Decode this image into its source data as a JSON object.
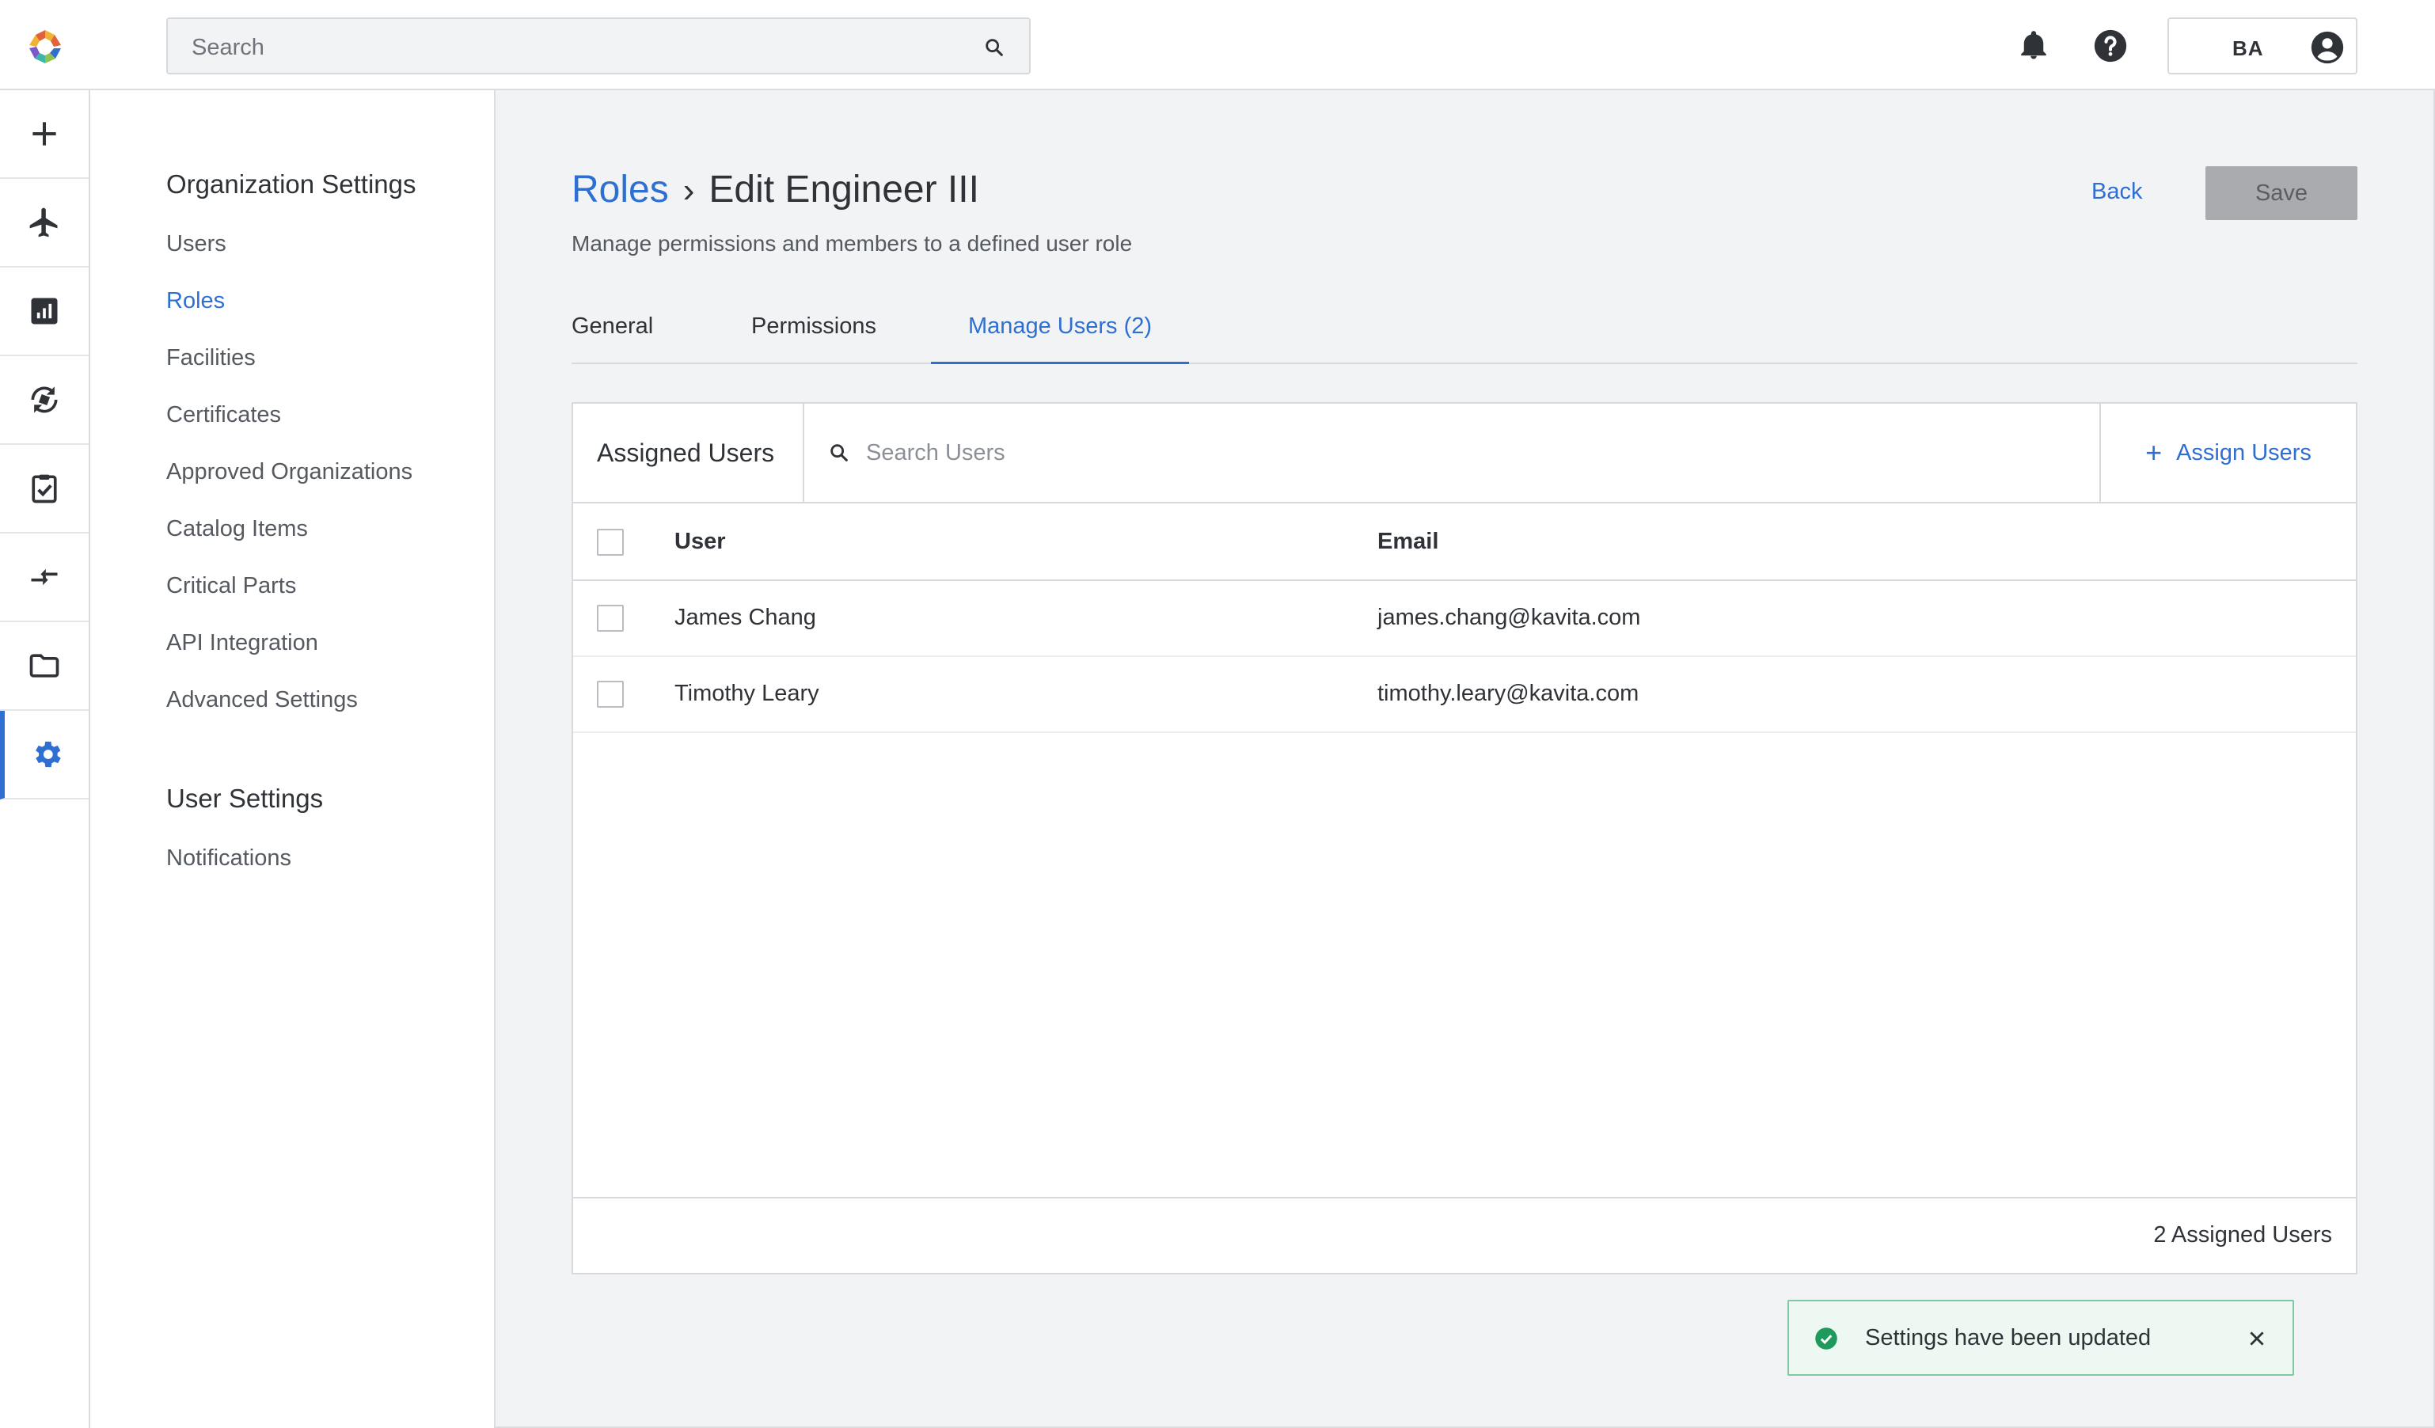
{
  "topbar": {
    "search_placeholder": "Search",
    "user_initials": "BA"
  },
  "rail": {
    "items": [
      {
        "icon": "plus-icon"
      },
      {
        "icon": "airplane-icon"
      },
      {
        "icon": "reports-icon"
      },
      {
        "icon": "parts-tracking-icon"
      },
      {
        "icon": "clipboard-check-icon"
      },
      {
        "icon": "swap-icon"
      },
      {
        "icon": "folder-icon"
      },
      {
        "icon": "settings-gear-icon",
        "active": true
      }
    ],
    "accent": "#2e6fd1"
  },
  "settings_nav": {
    "org_heading": "Organization Settings",
    "org_items": [
      {
        "label": "Users"
      },
      {
        "label": "Roles",
        "active": true
      },
      {
        "label": "Facilities"
      },
      {
        "label": "Certificates"
      },
      {
        "label": "Approved Organizations"
      },
      {
        "label": "Catalog Items"
      },
      {
        "label": "Critical Parts"
      },
      {
        "label": "API Integration"
      },
      {
        "label": "Advanced Settings"
      }
    ],
    "user_heading": "User Settings",
    "user_items": [
      {
        "label": "Notifications"
      }
    ]
  },
  "page": {
    "breadcrumb_link": "Roles",
    "separator": "›",
    "title": "Edit Engineer III",
    "subtitle": "Manage permissions and members to a defined user role",
    "back_label": "Back",
    "save_label": "Save"
  },
  "tabs": [
    {
      "label": "General"
    },
    {
      "label": "Permissions"
    },
    {
      "label": "Manage Users (2)",
      "active": true
    }
  ],
  "card": {
    "title": "Assigned Users",
    "search_placeholder": "Search Users",
    "assign_label": "Assign Users",
    "columns": {
      "user": "User",
      "email": "Email"
    },
    "rows": [
      {
        "user": "James Chang",
        "email": "james.chang@kavita.com"
      },
      {
        "user": "Timothy Leary",
        "email": "timothy.leary@kavita.com"
      }
    ],
    "footer": "2 Assigned Users"
  },
  "toast": {
    "message": "Settings have been updated",
    "status_color": "#1e9a5c"
  }
}
